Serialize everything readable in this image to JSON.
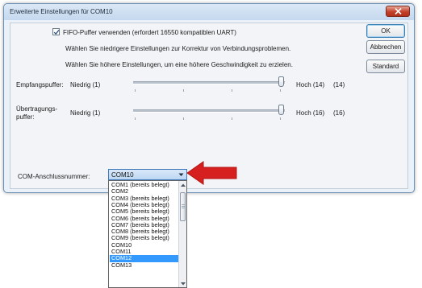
{
  "window": {
    "title": "Erweiterte Einstellungen für COM10"
  },
  "fifo": {
    "checkbox_label": "FIFO-Puffer verwenden (erfordert 16550 kompatiblen UART)",
    "checked": true,
    "hint_lower": "Wählen Sie niedrigere Einstellungen zur Korrektur von Verbindungsproblemen.",
    "hint_higher": "Wählen Sie höhere Einstellungen, um eine höhere Geschwindigkeit zu erzielen."
  },
  "receive_buffer": {
    "label": "Empfangspuffer:",
    "min_label": "Niedrig (1)",
    "max_label": "Hoch (14)",
    "value_label": "(14)",
    "level": 1.0
  },
  "transmit_buffer": {
    "label_line1": "Übertragungs-",
    "label_line2": "puffer:",
    "min_label": "Niedrig (1)",
    "max_label": "Hoch (16)",
    "value_label": "(16)",
    "level": 1.0
  },
  "buttons": {
    "ok": "OK",
    "cancel": "Abbrechen",
    "defaults": "Standard"
  },
  "com_port": {
    "label": "COM-Anschlussnummer:",
    "selected": "COM10",
    "options": [
      "COM1 (bereits belegt)",
      "COM2",
      "COM3 (bereits belegt)",
      "COM4 (bereits belegt)",
      "COM5 (bereits belegt)",
      "COM6 (bereits belegt)",
      "COM7 (bereits belegt)",
      "COM8 (bereits belegt)",
      "COM9 (bereits belegt)",
      "COM10",
      "COM11",
      "COM12",
      "COM13"
    ],
    "highlighted_option": "COM12"
  },
  "colors": {
    "callout_arrow": "#d61f1f",
    "selection": "#3399ff"
  }
}
